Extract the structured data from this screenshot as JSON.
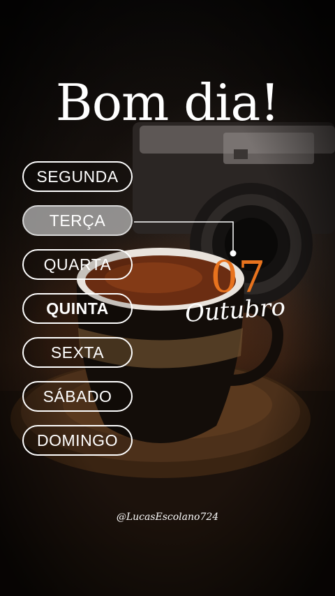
{
  "header": {
    "title": "Bom dia!"
  },
  "days": [
    {
      "label": "SEGUNDA",
      "active": false
    },
    {
      "label": "TERÇA",
      "active": true
    },
    {
      "label": "QUARTA",
      "active": false
    },
    {
      "label": "QUINTA",
      "active": false
    },
    {
      "label": "SEXTA",
      "active": false
    },
    {
      "label": "SÁBADO",
      "active": false
    },
    {
      "label": "DOMINGO",
      "active": false
    }
  ],
  "date": {
    "day": "07",
    "month": "Outubro"
  },
  "footer": {
    "handle": "@LucasEscolano724"
  },
  "colors": {
    "accent": "#e8731e",
    "text": "#ffffff",
    "active_pill": "#bebebe"
  }
}
